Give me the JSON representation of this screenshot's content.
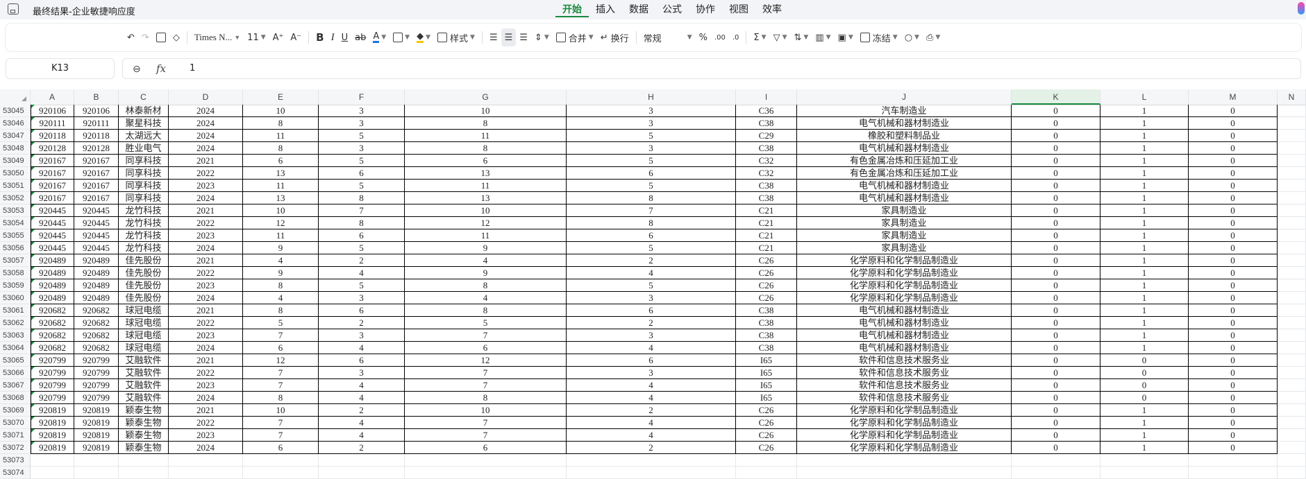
{
  "title": "最终结果-企业敏捷响应度",
  "menu": [
    "开始",
    "插入",
    "数据",
    "公式",
    "协作",
    "视图",
    "效率"
  ],
  "toolbar": {
    "font_name": "Times N...",
    "font_size": "11",
    "style_label": "样式",
    "merge_label": "合并",
    "wrap_label": "换行",
    "number_format": "常规",
    "freeze_label": "冻结"
  },
  "formula": {
    "cell_ref": "K13",
    "value": "1"
  },
  "columns": [
    "A",
    "B",
    "C",
    "D",
    "E",
    "F",
    "G",
    "H",
    "I",
    "J",
    "K",
    "L",
    "M",
    "N"
  ],
  "rows": [
    {
      "n": "53045",
      "cells": [
        "920106",
        "920106",
        "林泰新材",
        "2024",
        "10",
        "3",
        "10",
        "3",
        "C36",
        "汽车制造业",
        "0",
        "1",
        "0"
      ]
    },
    {
      "n": "53046",
      "cells": [
        "920111",
        "920111",
        "聚星科技",
        "2024",
        "8",
        "3",
        "8",
        "3",
        "C38",
        "电气机械和器材制造业",
        "0",
        "1",
        "0"
      ]
    },
    {
      "n": "53047",
      "cells": [
        "920118",
        "920118",
        "太湖远大",
        "2024",
        "11",
        "5",
        "11",
        "5",
        "C29",
        "橡胶和塑料制品业",
        "0",
        "1",
        "0"
      ]
    },
    {
      "n": "53048",
      "cells": [
        "920128",
        "920128",
        "胜业电气",
        "2024",
        "8",
        "3",
        "8",
        "3",
        "C38",
        "电气机械和器材制造业",
        "0",
        "1",
        "0"
      ]
    },
    {
      "n": "53049",
      "cells": [
        "920167",
        "920167",
        "同享科技",
        "2021",
        "6",
        "5",
        "6",
        "5",
        "C32",
        "有色金属冶炼和压延加工业",
        "0",
        "1",
        "0"
      ]
    },
    {
      "n": "53050",
      "cells": [
        "920167",
        "920167",
        "同享科技",
        "2022",
        "13",
        "6",
        "13",
        "6",
        "C32",
        "有色金属冶炼和压延加工业",
        "0",
        "1",
        "0"
      ]
    },
    {
      "n": "53051",
      "cells": [
        "920167",
        "920167",
        "同享科技",
        "2023",
        "11",
        "5",
        "11",
        "5",
        "C38",
        "电气机械和器材制造业",
        "0",
        "1",
        "0"
      ]
    },
    {
      "n": "53052",
      "cells": [
        "920167",
        "920167",
        "同享科技",
        "2024",
        "13",
        "8",
        "13",
        "8",
        "C38",
        "电气机械和器材制造业",
        "0",
        "1",
        "0"
      ]
    },
    {
      "n": "53053",
      "cells": [
        "920445",
        "920445",
        "龙竹科技",
        "2021",
        "10",
        "7",
        "10",
        "7",
        "C21",
        "家具制造业",
        "0",
        "1",
        "0"
      ]
    },
    {
      "n": "53054",
      "cells": [
        "920445",
        "920445",
        "龙竹科技",
        "2022",
        "12",
        "8",
        "12",
        "8",
        "C21",
        "家具制造业",
        "0",
        "1",
        "0"
      ]
    },
    {
      "n": "53055",
      "cells": [
        "920445",
        "920445",
        "龙竹科技",
        "2023",
        "11",
        "6",
        "11",
        "6",
        "C21",
        "家具制造业",
        "0",
        "1",
        "0"
      ]
    },
    {
      "n": "53056",
      "cells": [
        "920445",
        "920445",
        "龙竹科技",
        "2024",
        "9",
        "5",
        "9",
        "5",
        "C21",
        "家具制造业",
        "0",
        "1",
        "0"
      ]
    },
    {
      "n": "53057",
      "cells": [
        "920489",
        "920489",
        "佳先股份",
        "2021",
        "4",
        "2",
        "4",
        "2",
        "C26",
        "化学原料和化学制品制造业",
        "0",
        "1",
        "0"
      ]
    },
    {
      "n": "53058",
      "cells": [
        "920489",
        "920489",
        "佳先股份",
        "2022",
        "9",
        "4",
        "9",
        "4",
        "C26",
        "化学原料和化学制品制造业",
        "0",
        "1",
        "0"
      ]
    },
    {
      "n": "53059",
      "cells": [
        "920489",
        "920489",
        "佳先股份",
        "2023",
        "8",
        "5",
        "8",
        "5",
        "C26",
        "化学原料和化学制品制造业",
        "0",
        "1",
        "0"
      ]
    },
    {
      "n": "53060",
      "cells": [
        "920489",
        "920489",
        "佳先股份",
        "2024",
        "4",
        "3",
        "4",
        "3",
        "C26",
        "化学原料和化学制品制造业",
        "0",
        "1",
        "0"
      ]
    },
    {
      "n": "53061",
      "cells": [
        "920682",
        "920682",
        "球冠电缆",
        "2021",
        "8",
        "6",
        "8",
        "6",
        "C38",
        "电气机械和器材制造业",
        "0",
        "1",
        "0"
      ]
    },
    {
      "n": "53062",
      "cells": [
        "920682",
        "920682",
        "球冠电缆",
        "2022",
        "5",
        "2",
        "5",
        "2",
        "C38",
        "电气机械和器材制造业",
        "0",
        "1",
        "0"
      ]
    },
    {
      "n": "53063",
      "cells": [
        "920682",
        "920682",
        "球冠电缆",
        "2023",
        "7",
        "3",
        "7",
        "3",
        "C38",
        "电气机械和器材制造业",
        "0",
        "1",
        "0"
      ]
    },
    {
      "n": "53064",
      "cells": [
        "920682",
        "920682",
        "球冠电缆",
        "2024",
        "6",
        "4",
        "6",
        "4",
        "C38",
        "电气机械和器材制造业",
        "0",
        "1",
        "0"
      ]
    },
    {
      "n": "53065",
      "cells": [
        "920799",
        "920799",
        "艾融软件",
        "2021",
        "12",
        "6",
        "12",
        "6",
        "I65",
        "软件和信息技术服务业",
        "0",
        "0",
        "0"
      ]
    },
    {
      "n": "53066",
      "cells": [
        "920799",
        "920799",
        "艾融软件",
        "2022",
        "7",
        "3",
        "7",
        "3",
        "I65",
        "软件和信息技术服务业",
        "0",
        "0",
        "0"
      ]
    },
    {
      "n": "53067",
      "cells": [
        "920799",
        "920799",
        "艾融软件",
        "2023",
        "7",
        "4",
        "7",
        "4",
        "I65",
        "软件和信息技术服务业",
        "0",
        "0",
        "0"
      ]
    },
    {
      "n": "53068",
      "cells": [
        "920799",
        "920799",
        "艾融软件",
        "2024",
        "8",
        "4",
        "8",
        "4",
        "I65",
        "软件和信息技术服务业",
        "0",
        "0",
        "0"
      ]
    },
    {
      "n": "53069",
      "cells": [
        "920819",
        "920819",
        "颖泰生物",
        "2021",
        "10",
        "2",
        "10",
        "2",
        "C26",
        "化学原料和化学制品制造业",
        "0",
        "1",
        "0"
      ]
    },
    {
      "n": "53070",
      "cells": [
        "920819",
        "920819",
        "颖泰生物",
        "2022",
        "7",
        "4",
        "7",
        "4",
        "C26",
        "化学原料和化学制品制造业",
        "0",
        "1",
        "0"
      ]
    },
    {
      "n": "53071",
      "cells": [
        "920819",
        "920819",
        "颖泰生物",
        "2023",
        "7",
        "4",
        "7",
        "4",
        "C26",
        "化学原料和化学制品制造业",
        "0",
        "1",
        "0"
      ]
    },
    {
      "n": "53072",
      "cells": [
        "920819",
        "920819",
        "颖泰生物",
        "2024",
        "6",
        "2",
        "6",
        "2",
        "C26",
        "化学原料和化学制品制造业",
        "0",
        "1",
        "0"
      ]
    }
  ],
  "empty_rows": [
    "53073",
    "53074"
  ],
  "colors": {
    "accent": "#1a8a3e",
    "header_bg": "#f5f6f8"
  }
}
